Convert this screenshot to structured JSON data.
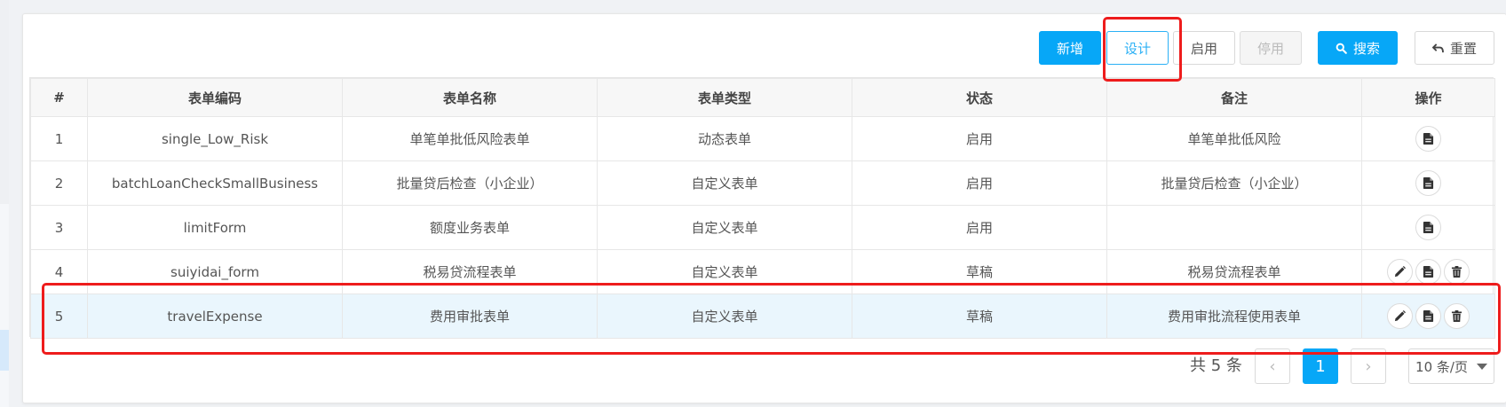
{
  "toolbar": {
    "add_label": "新增",
    "design_label": "设计",
    "enable_label": "启用",
    "disable_label": "停用",
    "search_label": "搜索",
    "reset_label": "重置"
  },
  "table": {
    "headers": [
      "#",
      "表单编码",
      "表单名称",
      "表单类型",
      "状态",
      "备注",
      "操作"
    ],
    "rows": [
      {
        "idx": "1",
        "code": "single_Low_Risk",
        "name": "单笔单批低风险表单",
        "type": "动态表单",
        "status": "启用",
        "remark": "单笔单批低风险",
        "actions": [
          "view"
        ]
      },
      {
        "idx": "2",
        "code": "batchLoanCheckSmallBusiness",
        "name": "批量贷后检查（小企业）",
        "type": "自定义表单",
        "status": "启用",
        "remark": "批量贷后检查（小企业）",
        "actions": [
          "view"
        ]
      },
      {
        "idx": "3",
        "code": "limitForm",
        "name": "额度业务表单",
        "type": "自定义表单",
        "status": "启用",
        "remark": "",
        "actions": [
          "view"
        ]
      },
      {
        "idx": "4",
        "code": "suiyidai_form",
        "name": "税易贷流程表单",
        "type": "自定义表单",
        "status": "草稿",
        "remark": "税易贷流程表单",
        "actions": [
          "edit",
          "view",
          "delete"
        ]
      },
      {
        "idx": "5",
        "code": "travelExpense",
        "name": "费用审批表单",
        "type": "自定义表单",
        "status": "草稿",
        "remark": "费用审批流程使用表单",
        "actions": [
          "edit",
          "view",
          "delete"
        ],
        "selected": true
      }
    ]
  },
  "pagination": {
    "total_text": "共 5 条",
    "current_page": "1",
    "prev_icon": "chevron-left-icon",
    "next_icon": "chevron-right-icon",
    "page_size_text": "10 条/页"
  },
  "colors": {
    "primary": "#07a7f7",
    "highlight_box": "#ee1c1c",
    "selected_row": "#eaf6fd"
  }
}
